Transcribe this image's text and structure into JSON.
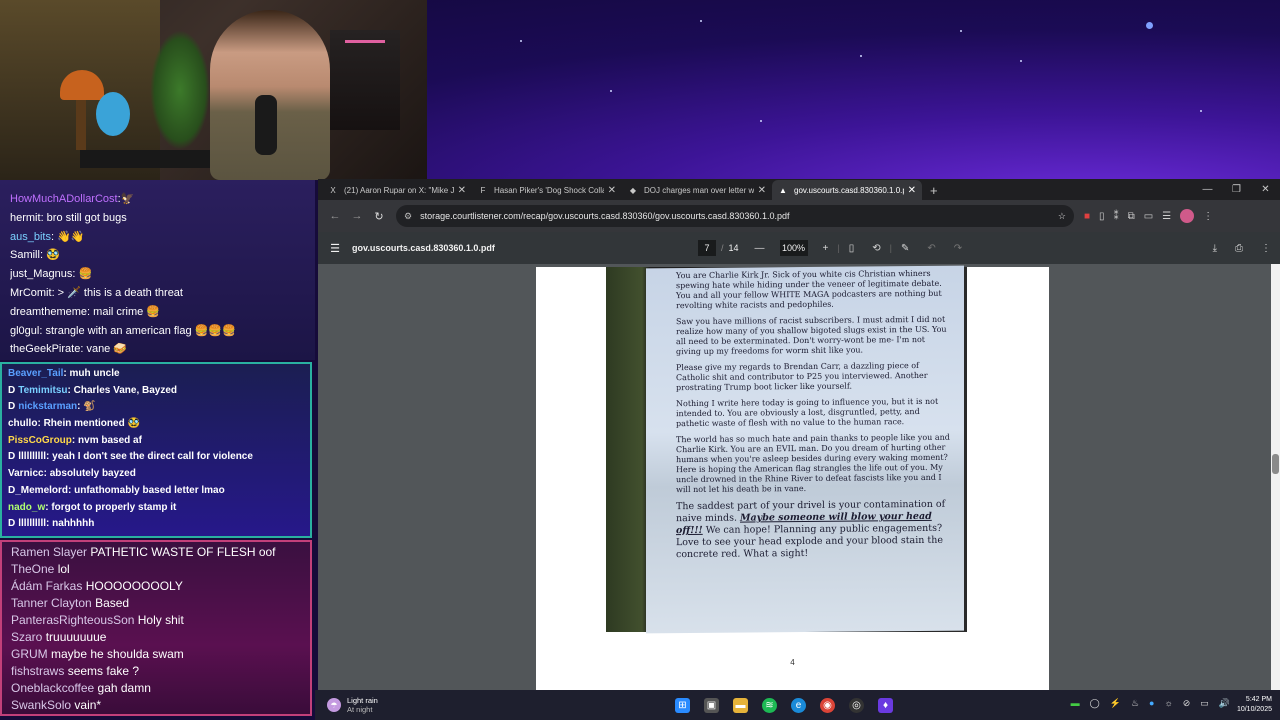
{
  "chat_top": [
    {
      "user": "HowMuchADollarCost",
      "sep": ":",
      "msg": "",
      "emote": "🦅",
      "color": "#c070ff"
    },
    {
      "user": "hermit",
      "sep": ":",
      "msg": " bro still got bugs",
      "emote": "",
      "color": "#ffffff"
    },
    {
      "user": "aus_bits",
      "sep": ":",
      "msg": " ",
      "emote": "👋👋",
      "color": "#7ad0ff"
    },
    {
      "user": "Samill",
      "sep": ":",
      "msg": " ",
      "emote": "🥸",
      "color": "#ffffff"
    },
    {
      "user": "just_Magnus",
      "sep": ":",
      "msg": " ",
      "emote": "🍔",
      "color": "#ffffff"
    },
    {
      "user": "MrComit",
      "sep": ":",
      "msg": " > ",
      "emote": "🗡️ this is a death threat",
      "color": "#ffffff"
    },
    {
      "user": "dreamthememe",
      "sep": ":",
      "msg": " mail crime ",
      "emote": "🍔",
      "color": "#ffffff"
    },
    {
      "user": "gl0gul",
      "sep": ":",
      "msg": " strangle with an american flag ",
      "emote": "🍔🍔🍔",
      "color": "#ffffff"
    },
    {
      "user": "theGeekPirate",
      "sep": ":",
      "msg": " vane ",
      "emote": "🥪",
      "color": "#ffffff"
    }
  ],
  "chat_mid": [
    {
      "user": "Beaver_Tail",
      "sep": ":",
      "msg": " muh uncle",
      "color": "#5aa0ff",
      "badge": ""
    },
    {
      "user": "Temimitsu",
      "sep": ":",
      "msg": " Charles Vane, Bayzed",
      "color": "#7ad0ff",
      "badge": "D"
    },
    {
      "user": "nickstarman",
      "sep": ":",
      "msg": " 🐒",
      "color": "#5aa0ff",
      "badge": "D"
    },
    {
      "user": "chullo",
      "sep": ":",
      "msg": " Rhein mentioned 🥸",
      "color": "#ffffff",
      "badge": ""
    },
    {
      "user": "PissCoGroup",
      "sep": ":",
      "msg": " nvm based af",
      "color": "#ffd84a",
      "badge": ""
    },
    {
      "user": "llllllllll",
      "sep": ":",
      "msg": " yeah I don't see the direct call for violence",
      "color": "#ffffff",
      "badge": "D"
    },
    {
      "user": "Varnicc",
      "sep": ":",
      "msg": " absolutely bayzed",
      "color": "#ffffff",
      "badge": ""
    },
    {
      "user": "D_Memelord",
      "sep": ":",
      "msg": " unfathomably based letter lmao",
      "color": "#ffffff",
      "badge": ""
    },
    {
      "user": "nado_w",
      "sep": ":",
      "msg": " forgot to properly stamp it",
      "color": "#b0ff70",
      "badge": ""
    },
    {
      "user": "llllllllll",
      "sep": ":",
      "msg": " nahhhhh",
      "color": "#ffffff",
      "badge": "D"
    }
  ],
  "chat_bottom": [
    {
      "user": "Ramen Slayer",
      "msg": "PATHETIC WASTE OF FLESH oof"
    },
    {
      "user": "TheOne",
      "msg": "lol"
    },
    {
      "user": "Ádám Farkas",
      "msg": "HOOOOOOOOLY"
    },
    {
      "user": "Tanner Clayton",
      "msg": "Based"
    },
    {
      "user": "PanterasRighteousSon",
      "msg": "Holy shit"
    },
    {
      "user": "Szaro",
      "msg": "truuuuuuue"
    },
    {
      "user": "GRUM",
      "msg": "maybe he shoulda swam"
    },
    {
      "user": "fishstraws",
      "msg": "seems fake ?"
    },
    {
      "user": "Oneblackcoffee",
      "msg": "gah damn"
    },
    {
      "user": "SwankSolo",
      "msg": "vain*"
    }
  ],
  "browser": {
    "tabs": [
      {
        "icon": "X",
        "title": "(21) Aaron Rupar on X: \"Mike Jo",
        "active": false
      },
      {
        "icon": "F",
        "title": "Hasan Piker's 'Dog Shock Colla",
        "active": false
      },
      {
        "icon": "◆",
        "title": "DOJ charges man over letter w",
        "active": false
      },
      {
        "icon": "▲",
        "title": "gov.uscourts.casd.830360.1.0.p",
        "active": true
      }
    ],
    "new_tab": "+",
    "url": "storage.courtlistener.com/recap/gov.uscourts.casd.830360/gov.uscourts.casd.830360.1.0.pdf"
  },
  "pdf": {
    "filename": "gov.uscourts.casd.830360.1.0.pdf",
    "page_current": "7",
    "page_separator": "/",
    "page_total": "14",
    "zoom": "100%",
    "page_number_label": "4",
    "letter": {
      "p1": "You are Charlie Kirk Jr. Sick of you white cis Christian whiners spewing hate while hiding under the veneer of legitimate debate. You and all your fellow WHITE MAGA podcasters are nothing but revolting white racists and pedophiles.",
      "p2": "Saw you have millions of racist subscribers. I must admit I did not realize how many of you shallow bigoted slugs exist in the US. You all need to be exterminated. Don't worry-wont be me- I'm not giving up my freedoms for worm shit like you.",
      "p3": "Please give my regards to Brendan Carr, a dazzling piece of Catholic shit and contributor to P25 you interviewed. Another prostrating Trump boot licker like yourself.",
      "p4": "Nothing I write here today is going to influence you, but it is not intended to. You are obviously a lost, disgruntled, petty, and pathetic waste of flesh with no value to the human race.",
      "p5": "The world has so much hate and pain thanks to people like you and Charlie Kirk. You are an EVIL man. Do you dream of hurting other humans when you're asleep besides during every waking moment? Here is hoping the American flag strangles the life out of you. My uncle drowned in the Rhine River to defeat fascists like you and I will not let his death be in vane.",
      "p6_start": "The saddest part of your drivel is your contamination of naive minds. ",
      "p6_bold": "Maybe someone will blow your head off!!!",
      "p6_end": " We can hope! Planning any public engagements? Love to see your head explode and your blood stain the concrete red. What a sight!"
    }
  },
  "taskbar": {
    "weather_label": "Light rain",
    "weather_sub": "At night",
    "time": "5:42 PM",
    "date": "10/10/2025"
  }
}
